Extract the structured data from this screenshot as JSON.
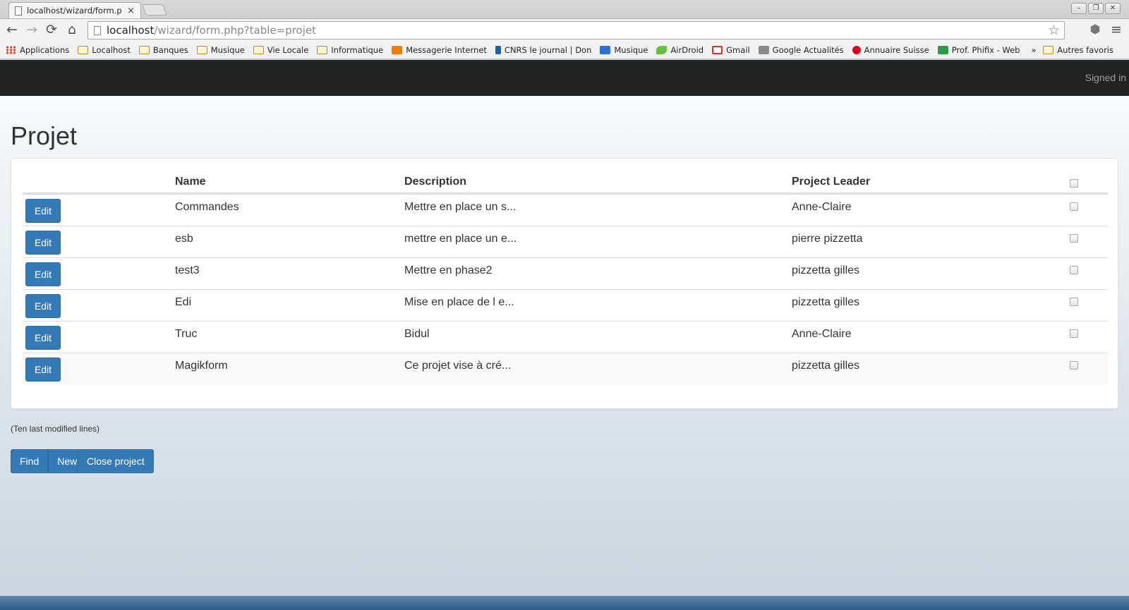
{
  "browser": {
    "tab_title": "localhost/wizard/form.p",
    "tab_close": "×",
    "url_host": "localhost",
    "url_path": "/wizard/form.php?table=projet",
    "window_controls": [
      "–",
      "❐",
      "✕"
    ],
    "nav_icons": {
      "back": "←",
      "forward": "→",
      "reload": "⟳",
      "home": "⌂",
      "star": "☆",
      "menu": "≡",
      "extension": "⬢"
    },
    "bookmarks": [
      {
        "label": "Applications",
        "icon": "apps-icon",
        "color": "#e34b3a"
      },
      {
        "label": "Localhost",
        "icon": "folder-icon",
        "color": "#b08c2e"
      },
      {
        "label": "Banques",
        "icon": "folder-icon",
        "color": "#b08c2e"
      },
      {
        "label": "Musique",
        "icon": "folder-icon",
        "color": "#b08c2e"
      },
      {
        "label": "Vie Locale",
        "icon": "folder-icon",
        "color": "#b08c2e"
      },
      {
        "label": "Informatique",
        "icon": "folder-icon",
        "color": "#b08c2e"
      },
      {
        "label": "Messagerie Internet",
        "icon": "mail-icon",
        "color": "#f07d00"
      },
      {
        "label": "CNRS le journal | Don",
        "icon": "cnrs-icon",
        "color": "#1f5fa8"
      },
      {
        "label": "Musique",
        "icon": "dsm-icon",
        "color": "#2a6fd6"
      },
      {
        "label": "AirDroid",
        "icon": "airdroid-icon",
        "color": "#6abf40"
      },
      {
        "label": "Gmail",
        "icon": "gmail-icon",
        "color": "#d93025"
      },
      {
        "label": "Google Actualités",
        "icon": "news-icon",
        "color": "#8a8a8a"
      },
      {
        "label": "Annuaire Suisse",
        "icon": "directory-icon",
        "color": "#d9001b"
      },
      {
        "label": "Prof. Phifix - Web",
        "icon": "phifix-icon",
        "color": "#2a9d3f"
      }
    ],
    "bookmarks_more": "»",
    "bookmarks_other": "Autres favoris"
  },
  "navbar": {
    "signed_in": "Signed in"
  },
  "page": {
    "title": "Projet",
    "columns": {
      "name": "Name",
      "description": "Description",
      "leader": "Project Leader"
    },
    "edit_label": "Edit",
    "rows": [
      {
        "name": "Commandes",
        "description": "Mettre en place un s...",
        "leader": "Anne-Claire"
      },
      {
        "name": "esb",
        "description": "mettre en place un e...",
        "leader": "pierre pizzetta"
      },
      {
        "name": "test3",
        "description": "Mettre en phase2",
        "leader": "pizzetta gilles"
      },
      {
        "name": "Edi",
        "description": "Mise en place de l e...",
        "leader": "pizzetta gilles"
      },
      {
        "name": "Truc",
        "description": "Bidul",
        "leader": "Anne-Claire"
      },
      {
        "name": "Magikform",
        "description": "Ce projet vise à cré...",
        "leader": "pizzetta gilles"
      }
    ],
    "note": "(Ten last modified lines)",
    "buttons": {
      "find": "Find",
      "new": "New",
      "close": "Close project"
    }
  },
  "colors": {
    "primary": "#337ab7",
    "navbar": "#222222",
    "taskbar": "#2c5a87"
  }
}
